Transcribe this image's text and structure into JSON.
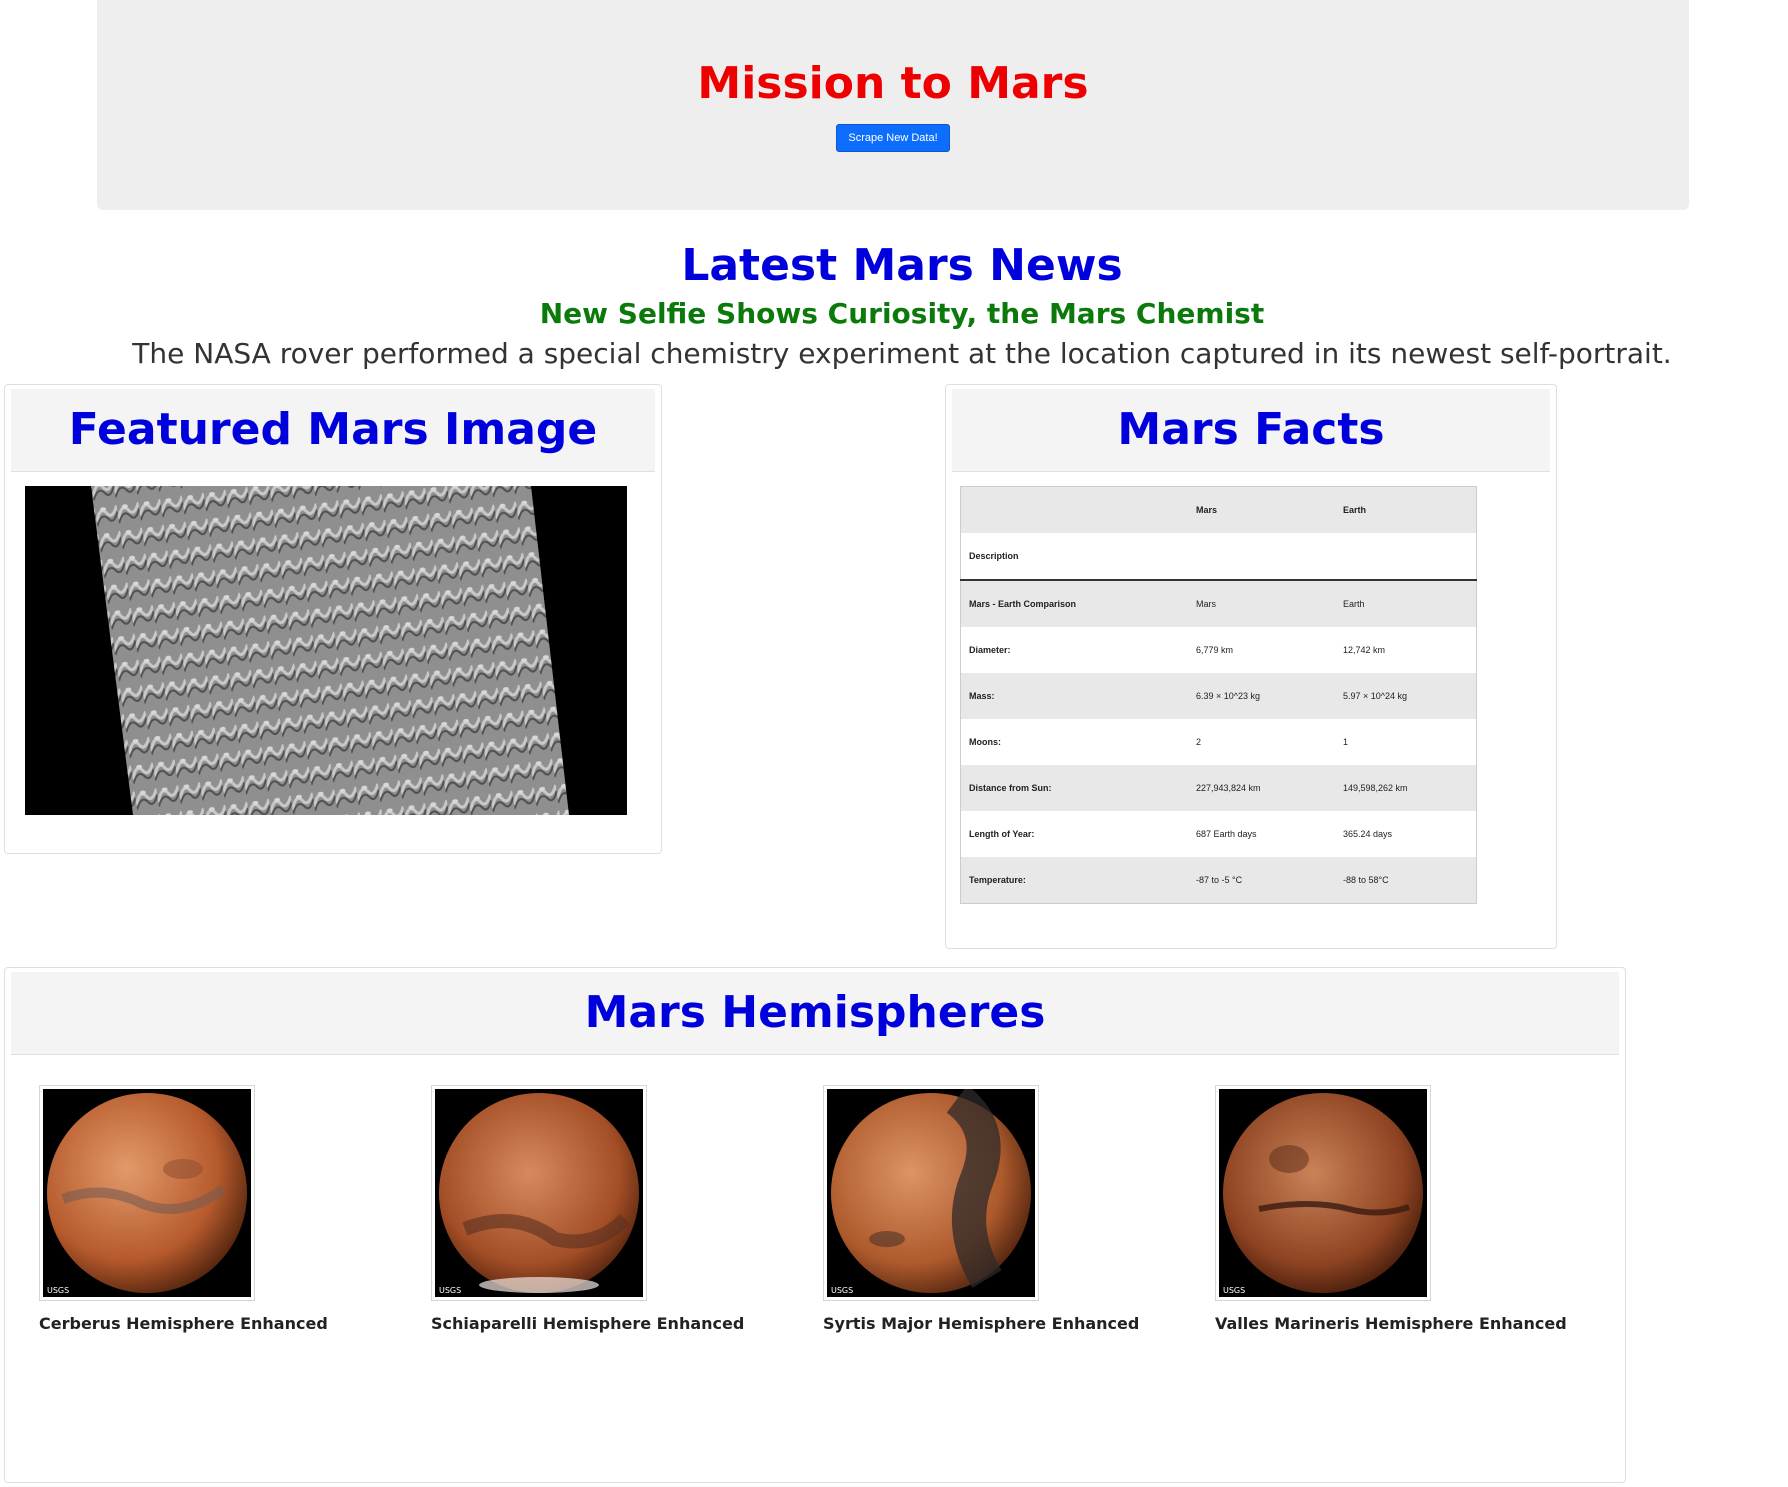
{
  "header": {
    "title": "Mission to Mars",
    "scrape_button": "Scrape New Data!"
  },
  "news": {
    "heading": "Latest Mars News",
    "title": "New Selfie Shows Curiosity, the Mars Chemist",
    "teaser": "The NASA rover performed a special chemistry experiment at the location captured in its newest self-portrait."
  },
  "featured": {
    "heading": "Featured Mars Image",
    "image_icon": "mars-dunes-image"
  },
  "facts": {
    "heading": "Mars Facts",
    "columns": [
      "",
      "Mars",
      "Earth"
    ],
    "index_label": "Description",
    "rows": [
      {
        "label": "Mars - Earth Comparison",
        "mars": "Mars",
        "earth": "Earth"
      },
      {
        "label": "Diameter:",
        "mars": "6,779 km",
        "earth": "12,742 km"
      },
      {
        "label": "Mass:",
        "mars": "6.39 × 10^23 kg",
        "earth": "5.97 × 10^24 kg"
      },
      {
        "label": "Moons:",
        "mars": "2",
        "earth": "1"
      },
      {
        "label": "Distance from Sun:",
        "mars": "227,943,824 km",
        "earth": "149,598,262 km"
      },
      {
        "label": "Length of Year:",
        "mars": "687 Earth days",
        "earth": "365.24 days"
      },
      {
        "label": "Temperature:",
        "mars": "-87 to -5 °C",
        "earth": "-88 to 58°C"
      }
    ]
  },
  "hemispheres": {
    "heading": "Mars Hemispheres",
    "items": [
      {
        "title": "Cerberus Hemisphere Enhanced"
      },
      {
        "title": "Schiaparelli Hemisphere Enhanced"
      },
      {
        "title": "Syrtis Major Hemisphere Enhanced"
      },
      {
        "title": "Valles Marineris Hemisphere Enhanced"
      }
    ]
  },
  "colors": {
    "title_red": "#ee0000",
    "heading_blue": "#0000dd",
    "news_green": "#0b7a0b",
    "button_blue": "#0d6efd"
  }
}
